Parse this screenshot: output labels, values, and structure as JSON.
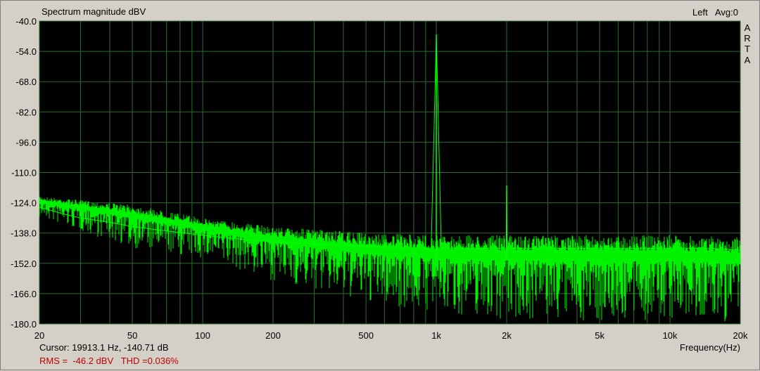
{
  "window": {
    "title": "Spectrum magnitude dBV",
    "channel": "Left",
    "averaging": "Avg:0",
    "brand_letters": [
      "A",
      "R",
      "T",
      "A"
    ],
    "cursor_readout": "Cursor: 19913.1 Hz, -140.71 dB",
    "stats_readout": "RMS =  -46.2 dBV   THD =0.036%",
    "stats_color": "#c00000"
  },
  "chart_data": {
    "type": "line",
    "title": "Spectrum magnitude dBV",
    "xlabel": "Frequency(Hz)",
    "ylabel": "",
    "x_scale": "log",
    "xlim": [
      20,
      20000
    ],
    "ylim": [
      -180,
      -40
    ],
    "grid": true,
    "background": "#000000",
    "grid_color": "#2e6b2e",
    "series_color": "#00ff00",
    "xticks": [
      {
        "value": 20,
        "label": "20"
      },
      {
        "value": 50,
        "label": "50"
      },
      {
        "value": 100,
        "label": "100"
      },
      {
        "value": 200,
        "label": "200"
      },
      {
        "value": 500,
        "label": "500"
      },
      {
        "value": 1000,
        "label": "1k"
      },
      {
        "value": 2000,
        "label": "2k"
      },
      {
        "value": 5000,
        "label": "5k"
      },
      {
        "value": 10000,
        "label": "10k"
      },
      {
        "value": 20000,
        "label": "20k"
      }
    ],
    "yticks": [
      -40.0,
      -54.0,
      -68.0,
      -82.0,
      -96.0,
      -110.0,
      -124.0,
      -138.0,
      -152.0,
      -166.0,
      -180.0
    ],
    "ytick_labels": [
      "-40.0",
      "-54.0",
      "-68.0",
      "-82.0",
      "-96.0",
      "-110.0",
      "-124.0",
      "-138.0",
      "-152.0",
      "-166.0",
      "-180.0"
    ],
    "series": [
      {
        "x": [
          20,
          25,
          30,
          40,
          50,
          70,
          100,
          150,
          200,
          300,
          500,
          700,
          950,
          1000,
          1050,
          1500,
          1990,
          2000,
          2010,
          3000,
          5000,
          10000,
          15000,
          20000
        ],
        "y": [
          -126,
          -129,
          -131,
          -133,
          -135,
          -137,
          -139,
          -141,
          -142,
          -143,
          -144,
          -145,
          -145,
          -46.2,
          -145,
          -145,
          -145,
          -116,
          -145,
          -145,
          -145,
          -145,
          -145,
          -146
        ]
      }
    ],
    "noise_band": {
      "x": [
        20,
        50,
        100,
        200,
        500,
        1000,
        2000,
        5000,
        10000,
        20000
      ],
      "upper": [
        -121,
        -125,
        -131,
        -135,
        -138,
        -139,
        -139,
        -139,
        -139,
        -140
      ],
      "lower": [
        -131,
        -145,
        -150,
        -160,
        -170,
        -175,
        -178,
        -179,
        -179,
        -180
      ]
    },
    "peaks": [
      {
        "x": 1000,
        "y": -46.2
      },
      {
        "x": 2000,
        "y": -116
      }
    ]
  }
}
